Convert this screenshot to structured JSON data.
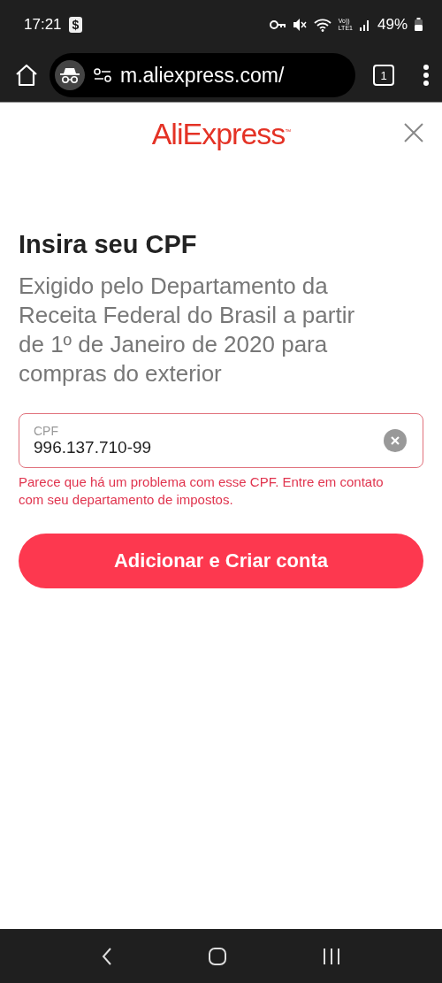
{
  "status_bar": {
    "time": "17:21",
    "app_badge": "$",
    "network_top": "Vo))",
    "network_bottom": "LTE1",
    "battery": "49%"
  },
  "browser": {
    "url": "m.aliexpress.com/",
    "tab_count": "1",
    "incognito": true
  },
  "logo": {
    "text": "AliExpress",
    "trademark": "™"
  },
  "title": "Insira seu CPF",
  "description": "Exigido pelo Departamento da Receita Federal do Brasil a partir de 1º de Janeiro de 2020 para compras do exterior",
  "field": {
    "label": "CPF",
    "value": "996.137.710-99",
    "error": true,
    "error_message": "Parece que há um problema com esse CPF. Entre em contato com seu departamento de impostos."
  },
  "submit_button": "Adicionar e Criar conta"
}
